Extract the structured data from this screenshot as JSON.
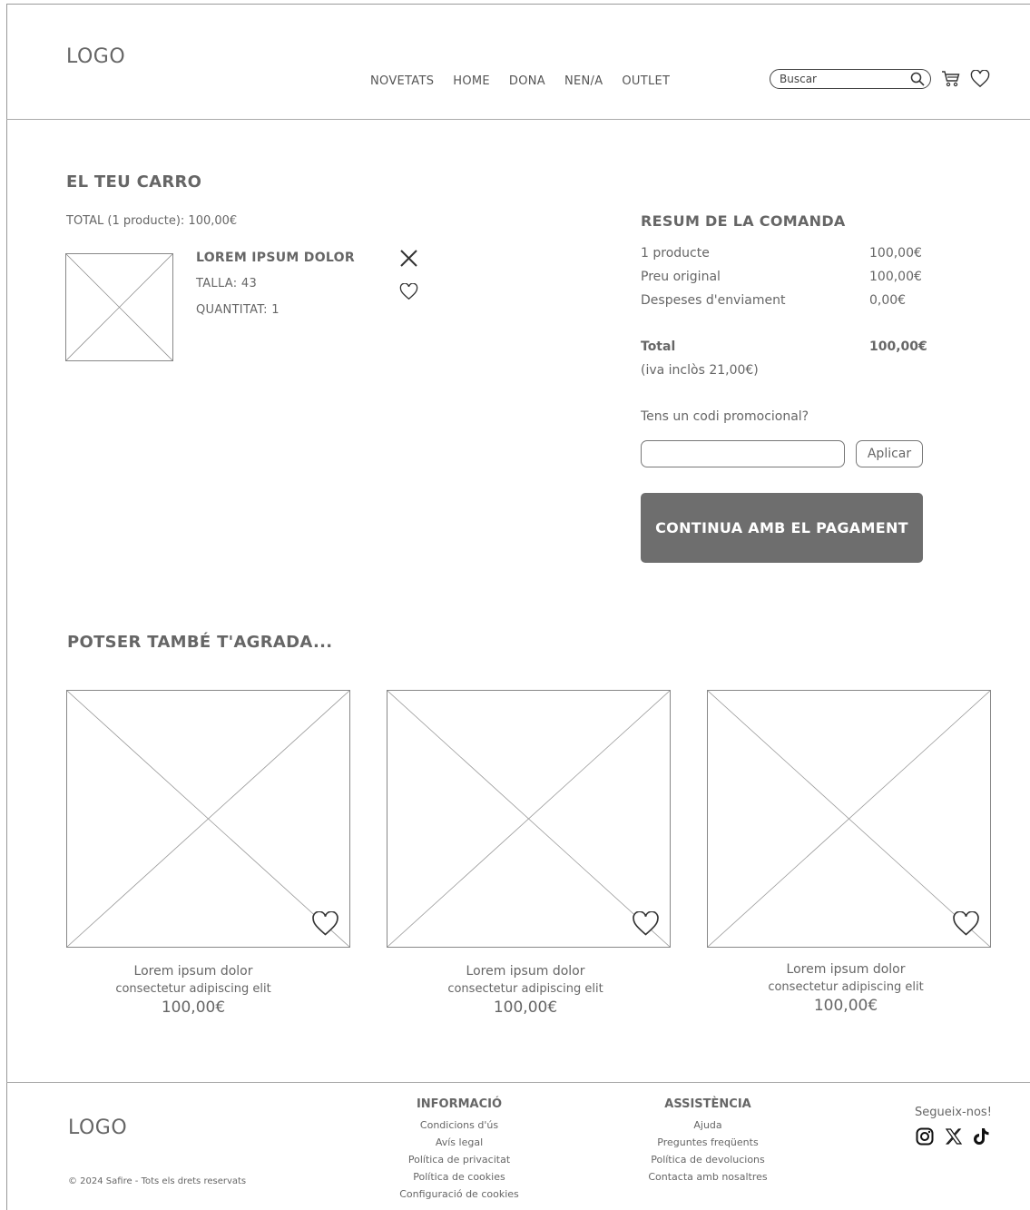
{
  "header": {
    "logo": "LOGO",
    "nav": [
      "NOVETATS",
      "HOME",
      "DONA",
      "NEN/A",
      "OUTLET"
    ],
    "search_placeholder": "Buscar",
    "icons": [
      "search-icon",
      "cart-icon",
      "heart-icon"
    ]
  },
  "cart": {
    "title": "EL TEU CARRO",
    "total_line": "TOTAL (1 producte): 100,00€",
    "item": {
      "name": "LOREM IPSUM DOLOR",
      "size": "TALLA: 43",
      "quantity": "QUANTITAT: 1"
    }
  },
  "summary": {
    "title": "RESUM DE LA COMANDA",
    "rows": [
      {
        "label": "1 producte",
        "value": "100,00€"
      },
      {
        "label": "Preu original",
        "value": "100,00€"
      },
      {
        "label": "Despeses d'enviament",
        "value": "0,00€"
      }
    ],
    "total_label": "Total",
    "total_value": "100,00€",
    "vat_note": "(iva inclòs 21,00€)",
    "promo_question": "Tens un codi promocional?",
    "promo_value": "",
    "apply_label": "Aplicar",
    "pay_label": "CONTINUA AMB EL PAGAMENT"
  },
  "recommendations": {
    "title": "POTSER TAMBÉ T'AGRADA...",
    "products": [
      {
        "name": "Lorem ipsum dolor",
        "desc": "consectetur adipiscing elit",
        "price": "100,00€"
      },
      {
        "name": "Lorem ipsum dolor",
        "desc": "consectetur adipiscing elit",
        "price": "100,00€"
      },
      {
        "name": "Lorem ipsum dolor",
        "desc": "consectetur adipiscing elit",
        "price": "100,00€"
      }
    ]
  },
  "footer": {
    "logo": "LOGO",
    "copyright": "© 2024 Safire - Tots els drets reservats",
    "info": {
      "title": "INFORMACIÓ",
      "links": [
        "Condicions d'ús",
        "Avís legal",
        "Política de privacitat",
        "Política de cookies",
        "Configuració de cookies"
      ]
    },
    "support": {
      "title": "ASSISTÈNCIA",
      "links": [
        "Ajuda",
        "Preguntes freqüents",
        "Política de devolucions",
        "Contacta amb nosaltres"
      ]
    },
    "social": {
      "title": "Segueix-nos!",
      "icons": [
        "instagram-icon",
        "x-icon",
        "tiktok-icon"
      ]
    }
  }
}
